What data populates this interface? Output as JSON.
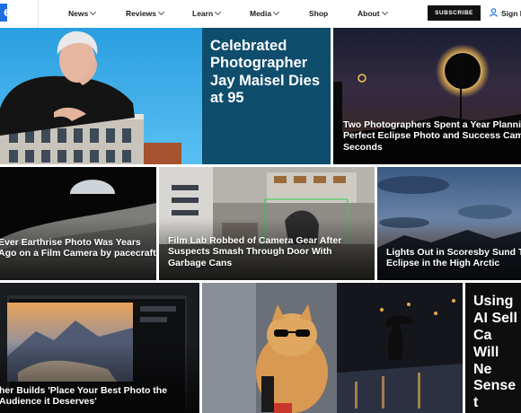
{
  "header": {
    "logo_text": "el",
    "nav": [
      "News",
      "Reviews",
      "Learn",
      "Media",
      "Shop",
      "About"
    ],
    "subscribe_label": "SUBSCRIBE",
    "signin_label": "Sign In"
  },
  "stories": [
    {
      "headline": "Celebrated Photographer Jay Maisel Dies at 95"
    },
    {
      "headline": "Two Photographers Spent a Year Planning the Perfect Eclipse Photo and Success Came in 30 Seconds"
    },
    {
      "headline": "Ever Earthrise Photo Was Years Ago on a Film Camera by pacecraft"
    },
    {
      "headline": "Film Lab Robbed of Camera Gear After Suspects Smash Through Door With Garbage Cans"
    },
    {
      "headline": "Lights Out in Scoresby Sund Total Eclipse in the High Arctic"
    },
    {
      "headline": "her Builds 'Place Your Best Photo the Audience it Deserves'"
    },
    {
      "headline": ""
    },
    {
      "headline": "Using AI Sell Ca Will Ne Sense t"
    }
  ],
  "colors": {
    "accent": "#1d6fe0",
    "feature_bg": "#0f4d6c",
    "subscribe_bg": "#111111"
  }
}
